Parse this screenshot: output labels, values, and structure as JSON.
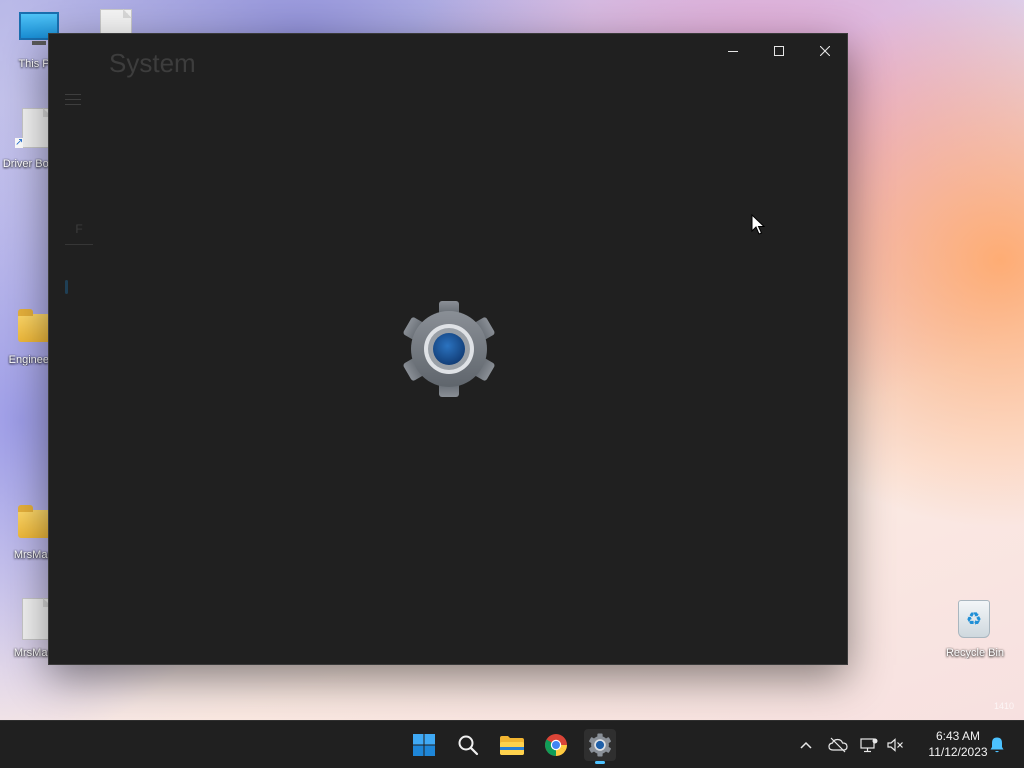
{
  "desktop": {
    "icons": [
      {
        "label": "This PC"
      },
      {
        "label": "Driver Booster"
      },
      {
        "label": "Engineering"
      },
      {
        "label": "MrsMarks"
      },
      {
        "label": "MrsMarks"
      },
      {
        "label": "Recycle Bin"
      }
    ],
    "watermark": "1410"
  },
  "window": {
    "title": "System",
    "search_glyph": "F",
    "controls": {
      "minimize": "—",
      "maximize": "☐",
      "close": "✕"
    },
    "center_icon": "settings-gear-icon"
  },
  "taskbar": {
    "apps": [
      "start-icon",
      "search-icon",
      "file-explorer-icon",
      "chrome-icon",
      "settings-icon"
    ],
    "active_app": "settings-icon",
    "tray": {
      "chevron": "^"
    },
    "clock": {
      "time": "6:43 AM",
      "date": "11/12/2023"
    }
  },
  "colors": {
    "accent": "#4cc2ff",
    "window_bg": "#202020",
    "gear_center": "#1e5fa8"
  }
}
